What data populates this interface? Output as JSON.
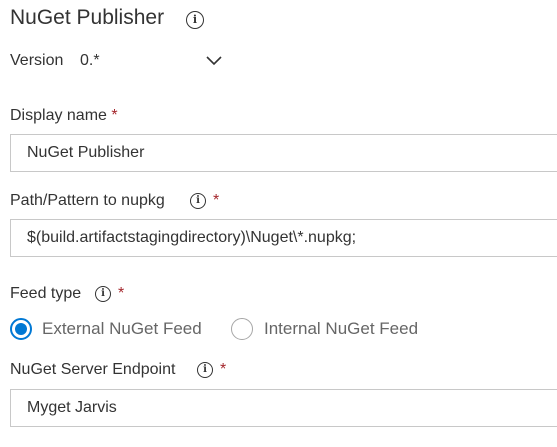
{
  "task": {
    "title": "NuGet Publisher",
    "info_icon": "info-icon"
  },
  "version": {
    "label": "Version",
    "selected": "0.*",
    "icon": "chevron-down-icon"
  },
  "display_name": {
    "label": "Display name",
    "required_mark": "*",
    "value": "NuGet Publisher"
  },
  "path_pattern": {
    "label": "Path/Pattern to nupkg",
    "required_mark": "*",
    "value": "$(build.artifactstagingdirectory)\\Nuget\\*.nupkg;"
  },
  "feed_type": {
    "label": "Feed type",
    "required_mark": "*",
    "options": [
      {
        "label": "External NuGet Feed",
        "selected": true
      },
      {
        "label": "Internal NuGet Feed",
        "selected": false
      }
    ]
  },
  "server_endpoint": {
    "label": "NuGet Server Endpoint",
    "required_mark": "*",
    "value": "Myget Jarvis"
  },
  "colors": {
    "accent": "#0078d4",
    "required": "#a4262c",
    "text": "#333333",
    "border": "#c8c8c8"
  }
}
